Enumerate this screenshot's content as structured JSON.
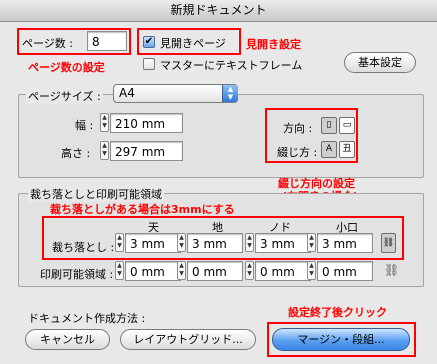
{
  "window": {
    "title": "新規ドキュメント"
  },
  "pages": {
    "count_label": "ページ数 :",
    "count_value": "8",
    "facing_pages_label": "見開きページ",
    "facing_pages_checked": true,
    "master_text_frame_label": "マスターにテキストフレーム",
    "master_text_frame_checked": false,
    "basic_settings_button": "基本設定"
  },
  "page_size": {
    "group_label": "ページサイズ :",
    "selected": "A4",
    "width_label": "幅 :",
    "width_value": "210 mm",
    "height_label": "高さ :",
    "height_value": "297 mm",
    "orientation_label": "方向 :",
    "binding_label": "綴じ方 :"
  },
  "bleed": {
    "group_label": "裁ち落としと印刷可能領域",
    "headers": [
      "天",
      "地",
      "ノド",
      "小口"
    ],
    "bleed_label": "裁ち落とし :",
    "bleed_values": [
      "3 mm",
      "3 mm",
      "3 mm",
      "3 mm"
    ],
    "slug_label": "印刷可能領域 :",
    "slug_values": [
      "0 mm",
      "0 mm",
      "0 mm",
      "0 mm"
    ]
  },
  "creation": {
    "label": "ドキュメント作成方法 :",
    "cancel_button": "キャンセル",
    "layout_grid_button": "レイアウトグリッド...",
    "margins_columns_button": "マージン・段組..."
  },
  "annotations": {
    "facing_setting": "見開き設定",
    "page_count_setting": "ページ数の設定",
    "binding_direction_line1": "綴じ方向の設定",
    "binding_direction_line2": "(左開きの場合)",
    "bleed_note": "裁ち落としがある場合は3mmにする",
    "finish_click": "設定終了後クリック"
  },
  "colors": {
    "annotation_red": "#ff0000",
    "primary_button_blue": "#3a86e6"
  },
  "icons": {
    "portrait": "portrait-orientation-icon",
    "landscape": "landscape-orientation-icon",
    "bind_left": "left-binding-icon",
    "bind_right": "right-binding-icon",
    "link": "chain-link-icon"
  }
}
